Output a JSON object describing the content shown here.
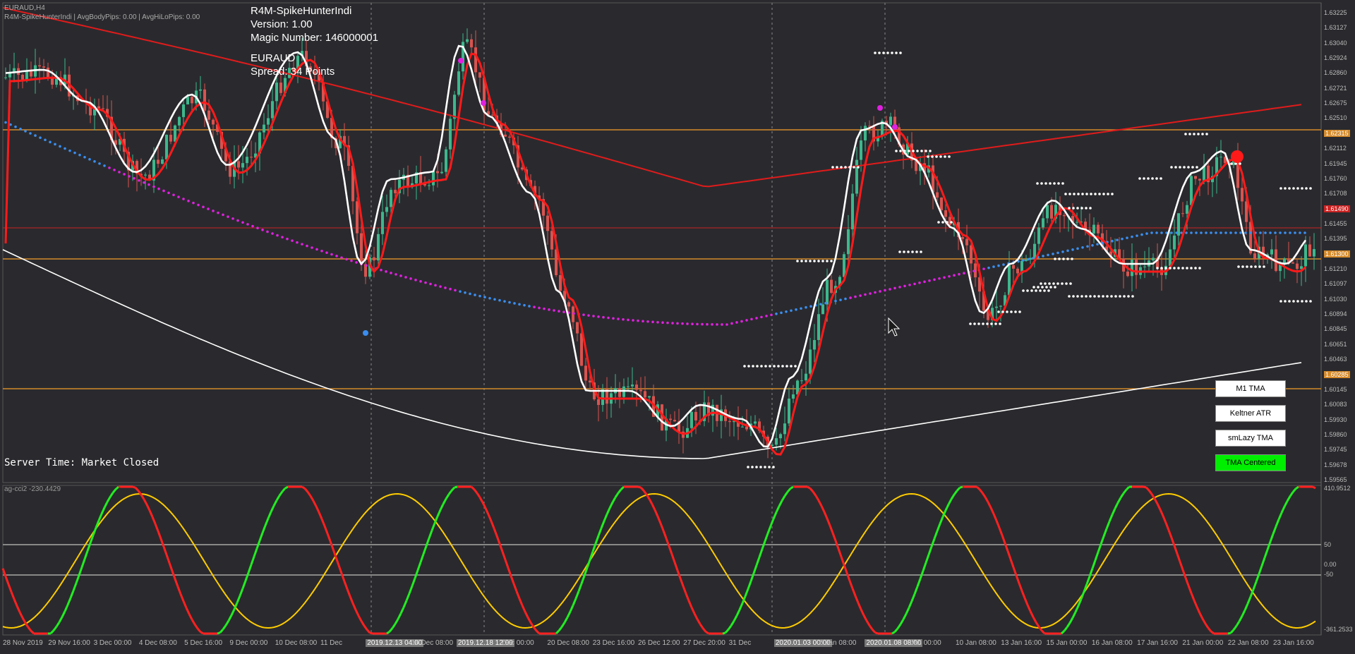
{
  "window": {
    "symbol_header": "EURAUD,H4",
    "indicator_header": "R4M-SpikeHunterIndi | AvgBodyPips: 0.00 | AvgHiLoPips: 0.00"
  },
  "ea_info": {
    "name": "R4M-SpikeHunterIndi",
    "version": "Version: 1.00",
    "magic": "Magic Number: 146000001",
    "symbol": "EURAUD",
    "spread": "Spread: 34 Points"
  },
  "server_time": "Server Time: Market Closed",
  "subwindow_label": "ag-cci2 -230.4429",
  "buttons": [
    {
      "label": "M1 TMA",
      "active": false
    },
    {
      "label": "Keltner ATR",
      "active": false
    },
    {
      "label": "smLazy TMA",
      "active": false
    },
    {
      "label": "TMA Centered",
      "active": true
    }
  ],
  "price_axis": [
    {
      "label": "1.63225"
    },
    {
      "label": "1.63127"
    },
    {
      "label": "1.63040"
    },
    {
      "label": "1.62924"
    },
    {
      "label": "1.62860"
    },
    {
      "label": "1.62721"
    },
    {
      "label": "1.62675"
    },
    {
      "label": "1.62510"
    },
    {
      "label": "1.62315",
      "color": "#d58a2a"
    },
    {
      "label": "1.62112"
    },
    {
      "label": "1.61945"
    },
    {
      "label": "1.61760"
    },
    {
      "label": "1.61708"
    },
    {
      "label": "1.61490",
      "color": "#cc2222"
    },
    {
      "label": "1.61455"
    },
    {
      "label": "1.61395"
    },
    {
      "label": "1.61300",
      "color": "#d58a2a"
    },
    {
      "label": "1.61210"
    },
    {
      "label": "1.61097"
    },
    {
      "label": "1.61030"
    },
    {
      "label": "1.60894"
    },
    {
      "label": "1.60845"
    },
    {
      "label": "1.60651"
    },
    {
      "label": "1.60463"
    },
    {
      "label": "1.60285",
      "color": "#d58a2a"
    },
    {
      "label": "1.60145"
    },
    {
      "label": "1.60083"
    },
    {
      "label": "1.59930"
    },
    {
      "label": "1.59860"
    },
    {
      "label": "1.59745"
    },
    {
      "label": "1.59678"
    },
    {
      "label": "1.59565"
    }
  ],
  "sub_axis": [
    {
      "label": "410.9512"
    },
    {
      "label": "50"
    },
    {
      "label": "0.00"
    },
    {
      "label": "-50"
    },
    {
      "label": "-361.2533"
    }
  ],
  "time_axis": [
    {
      "label": "28 Nov 2019"
    },
    {
      "label": "29 Nov 16:00"
    },
    {
      "label": "3 Dec 00:00"
    },
    {
      "label": "4 Dec 08:00"
    },
    {
      "label": "5 Dec 16:00"
    },
    {
      "label": "9 Dec 00:00"
    },
    {
      "label": "10 Dec 08:00"
    },
    {
      "label": "11 Dec"
    },
    {
      "label": "2019.12.13 04:00",
      "hl": true
    },
    {
      "label": "16 Dec 08:00"
    },
    {
      "label": "2019.12.18 12:00",
      "hl": true
    },
    {
      "label": "Dec 00:00"
    },
    {
      "label": "20 Dec 08:00"
    },
    {
      "label": "23 Dec 16:00"
    },
    {
      "label": "26 Dec 12:00"
    },
    {
      "label": "27 Dec 20:00"
    },
    {
      "label": "31 Dec"
    },
    {
      "label": "2020.01.03 00:00",
      "hl": true
    },
    {
      "label": "6 Jan 08:00"
    },
    {
      "label": "2020.01.08 08:00",
      "hl": true
    },
    {
      "label": "Jan 00:00"
    },
    {
      "label": "10 Jan 08:00"
    },
    {
      "label": "13 Jan 16:00"
    },
    {
      "label": "15 Jan 00:00"
    },
    {
      "label": "16 Jan 08:00"
    },
    {
      "label": "17 Jan 16:00"
    },
    {
      "label": "21 Jan 00:00"
    },
    {
      "label": "22 Jan 08:00"
    },
    {
      "label": "23 Jan 16:00"
    }
  ],
  "colors": {
    "background": "#2a2a2e",
    "bull": "#3cb88c",
    "bear": "#d9534f",
    "tma": "#ff1a1a",
    "fast_line": "#ffffff",
    "slow_line": "#ffffff",
    "ma_red": "#e01b1b",
    "dots_blue": "#3a8ef0",
    "dots_magenta": "#e020e0",
    "level_orange": "#d58a2a",
    "osc_green": "#22ee22",
    "osc_red": "#ff2020",
    "osc_yellow": "#ffcc00"
  }
}
